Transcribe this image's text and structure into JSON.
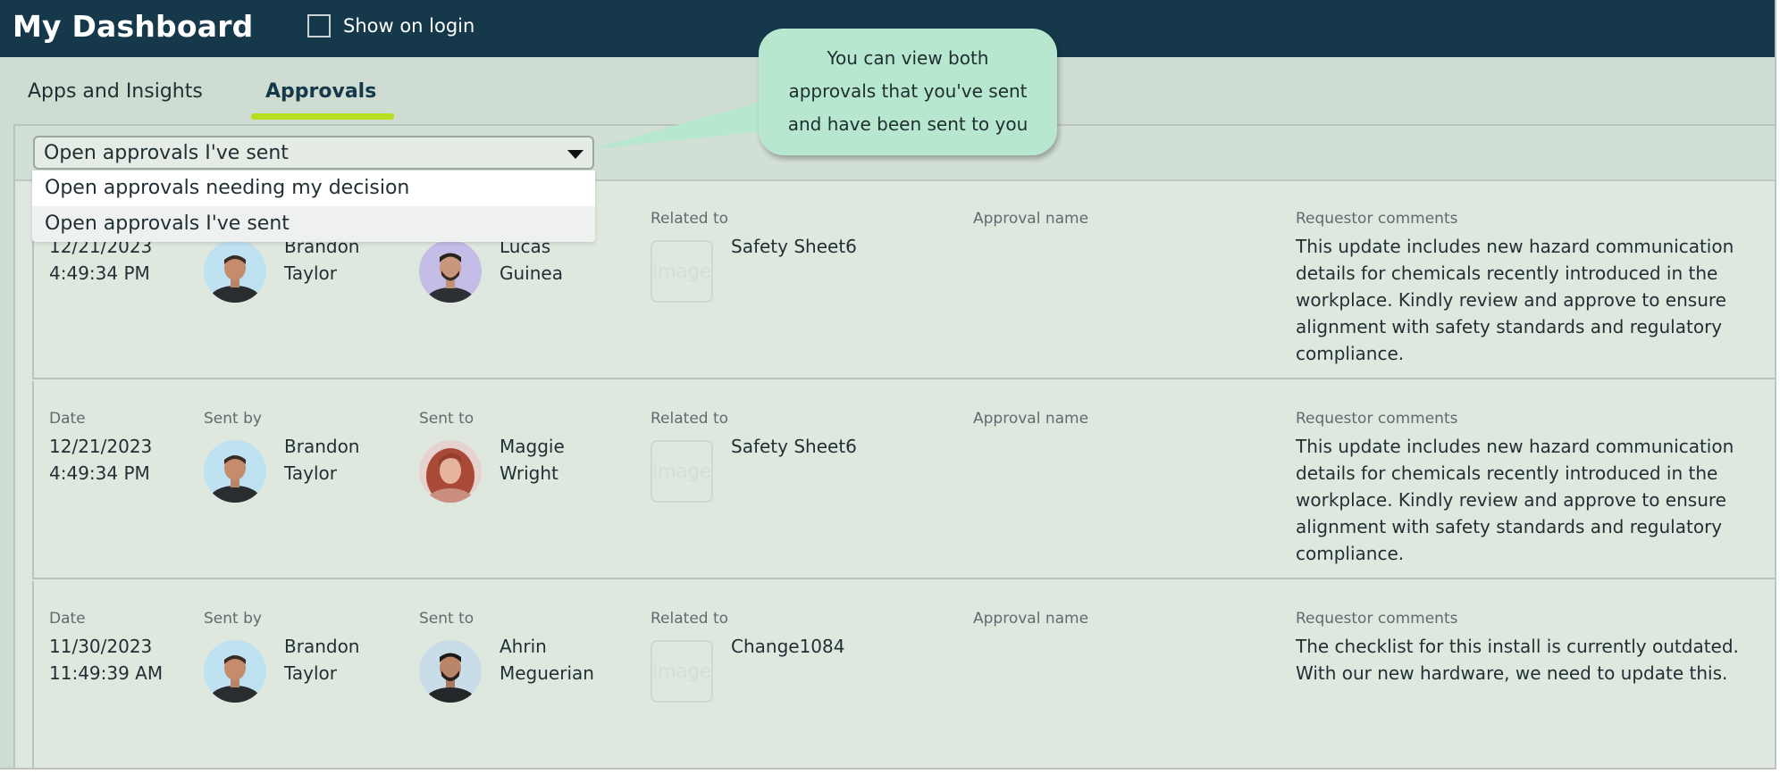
{
  "app": {
    "title": "My Dashboard"
  },
  "header": {
    "show_on_login_label": "Show on login"
  },
  "tabs": [
    {
      "label": "Apps and Insights"
    },
    {
      "label": "Approvals"
    }
  ],
  "filter": {
    "value": "Open approvals I've sent",
    "options": [
      "Open approvals needing my decision",
      "Open approvals I've sent"
    ]
  },
  "callout": {
    "lines": [
      "You can view both",
      "approvals that you've sent",
      "and have been sent to you"
    ]
  },
  "columns": {
    "date": "Date",
    "sent_by": "Sent by",
    "sent_to": "Sent to",
    "related_to": "Related to",
    "approval_name": "Approval name",
    "requestor_comments": "Requestor comments"
  },
  "thumb_placeholder": "image",
  "rows": [
    {
      "date": [
        "12/21/2023",
        "4:49:34 PM"
      ],
      "sent_by": [
        "Brandon",
        "Taylor"
      ],
      "sent_to": [
        "Lucas",
        "Guinea"
      ],
      "related_to": "Safety Sheet6",
      "approval_name": "",
      "comments": [
        "This update includes new hazard communication",
        "details for chemicals recently introduced in the",
        "workplace. Kindly review and approve to ensure",
        "alignment with safety standards and regulatory",
        "compliance."
      ]
    },
    {
      "date": [
        "12/21/2023",
        "4:49:34 PM"
      ],
      "sent_by": [
        "Brandon",
        "Taylor"
      ],
      "sent_to": [
        "Maggie",
        "Wright"
      ],
      "related_to": "Safety Sheet6",
      "approval_name": "",
      "comments": [
        "This update includes new hazard communication",
        "details for chemicals recently introduced in the",
        "workplace. Kindly review and approve to ensure",
        "alignment with safety standards and regulatory",
        "compliance."
      ]
    },
    {
      "date": [
        "11/30/2023",
        "11:49:39 AM"
      ],
      "sent_by": [
        "Brandon",
        "Taylor"
      ],
      "sent_to": [
        "Ahrin",
        "Meguerian"
      ],
      "related_to": "Change1084",
      "approval_name": "",
      "comments": [
        "The checklist for this install is currently outdated.",
        "With our new hardware, we need to update this."
      ]
    }
  ],
  "colors": {
    "topbar": "#15394a",
    "tab_underline": "#b8df1f",
    "callout": "#b7e7cf",
    "panel": "#dfe8df"
  }
}
